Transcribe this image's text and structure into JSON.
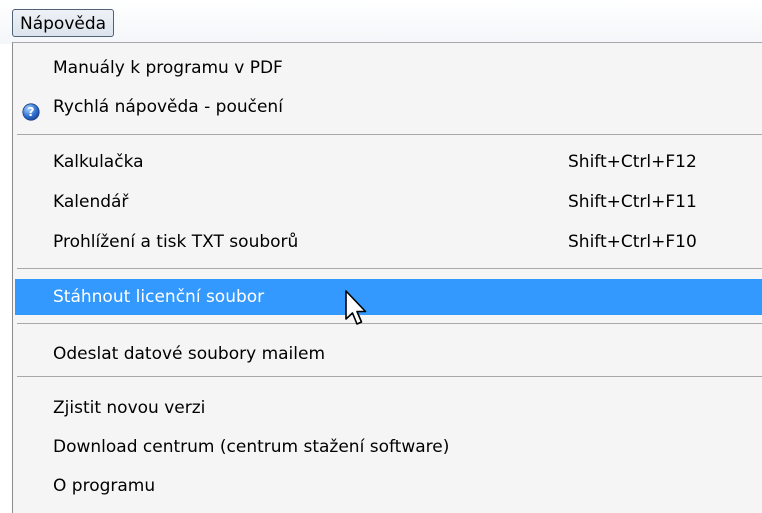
{
  "menu": {
    "title": "Nápověda",
    "items": [
      {
        "label": "Manuály k programu v PDF"
      },
      {
        "label": "Rychlá nápověda - poučení",
        "icon": "help-icon"
      },
      {
        "label": "Kalkulačka",
        "shortcut": "Shift+Ctrl+F12"
      },
      {
        "label": "Kalendář",
        "shortcut": "Shift+Ctrl+F11"
      },
      {
        "label": "Prohlížení a tisk TXT souborů",
        "shortcut": "Shift+Ctrl+F10"
      },
      {
        "label": "Stáhnout licenční soubor",
        "highlighted": true
      },
      {
        "label": "Odeslat datové soubory mailem"
      },
      {
        "label": "Zjistit novou verzi"
      },
      {
        "label": "Download centrum (centrum stažení software)"
      },
      {
        "label": "O programu"
      }
    ]
  },
  "colors": {
    "highlight": "#3399ff",
    "menu_background": "#f5f5f5"
  }
}
